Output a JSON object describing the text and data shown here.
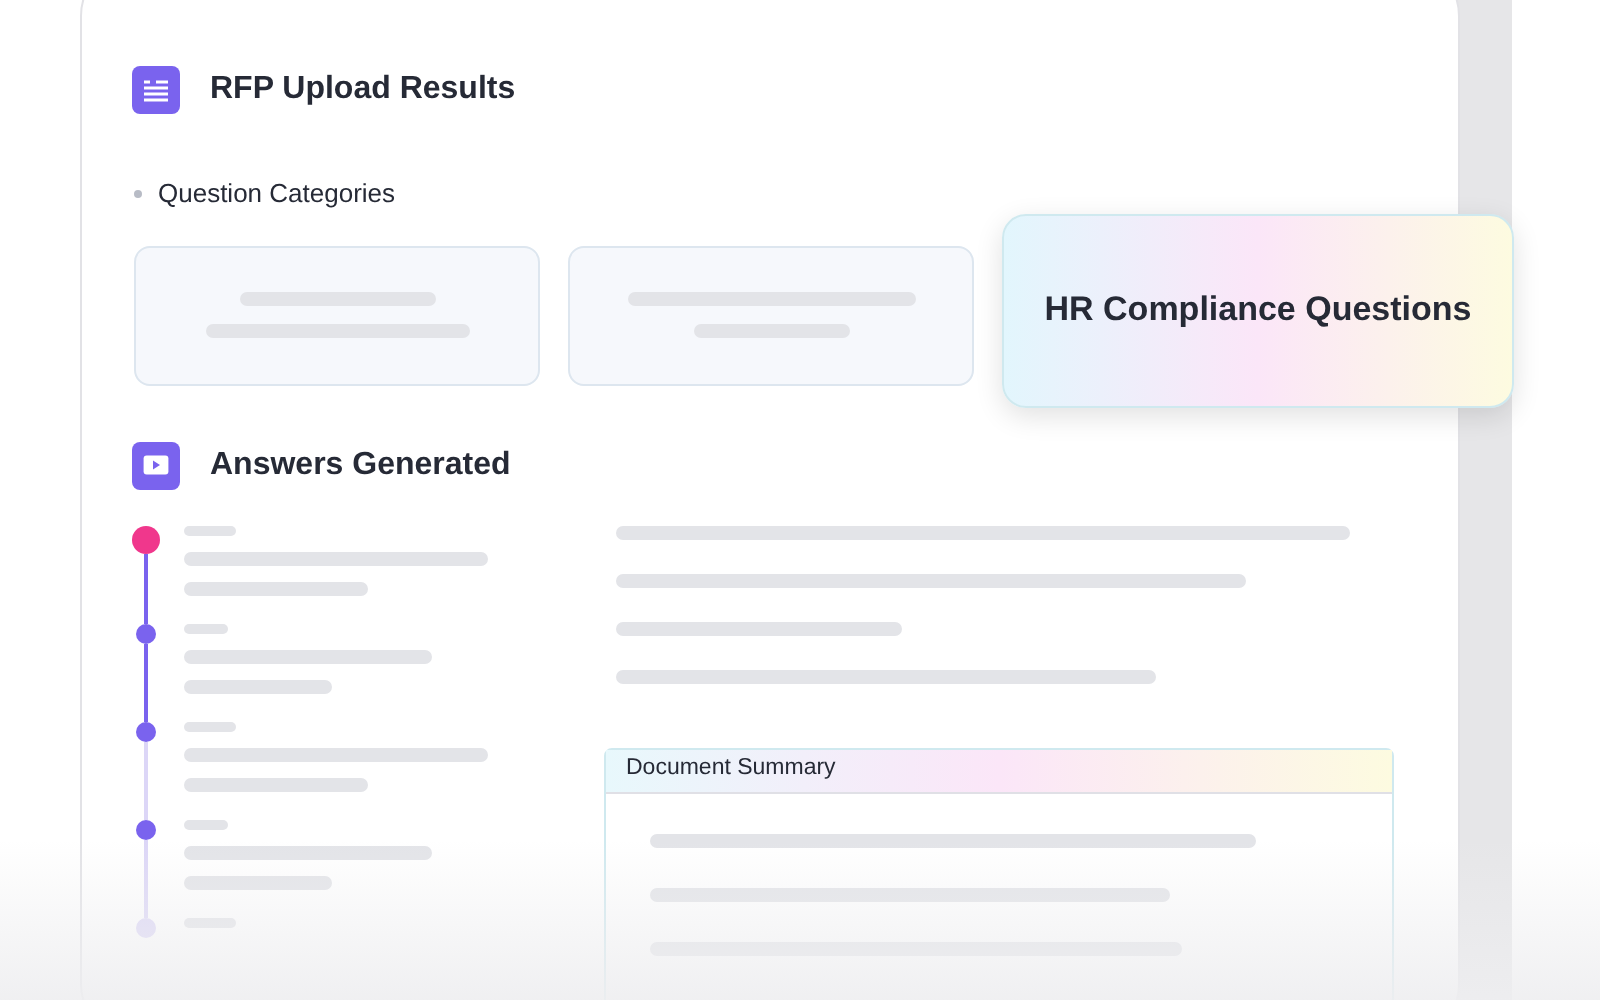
{
  "header": {
    "title": "RFP Upload Results"
  },
  "categories": {
    "label": "Question Categories",
    "items": [
      {
        "kind": "placeholder",
        "selected": false
      },
      {
        "kind": "placeholder",
        "selected": false
      },
      {
        "kind": "label",
        "title": "HR Compliance Questions",
        "selected": true
      }
    ]
  },
  "answers": {
    "title": "Answers Generated",
    "steps": [
      {
        "kind": "active"
      },
      {
        "kind": "done"
      },
      {
        "kind": "done"
      },
      {
        "kind": "done"
      },
      {
        "kind": "pending"
      }
    ]
  },
  "summary": {
    "title": "Document Summary"
  }
}
